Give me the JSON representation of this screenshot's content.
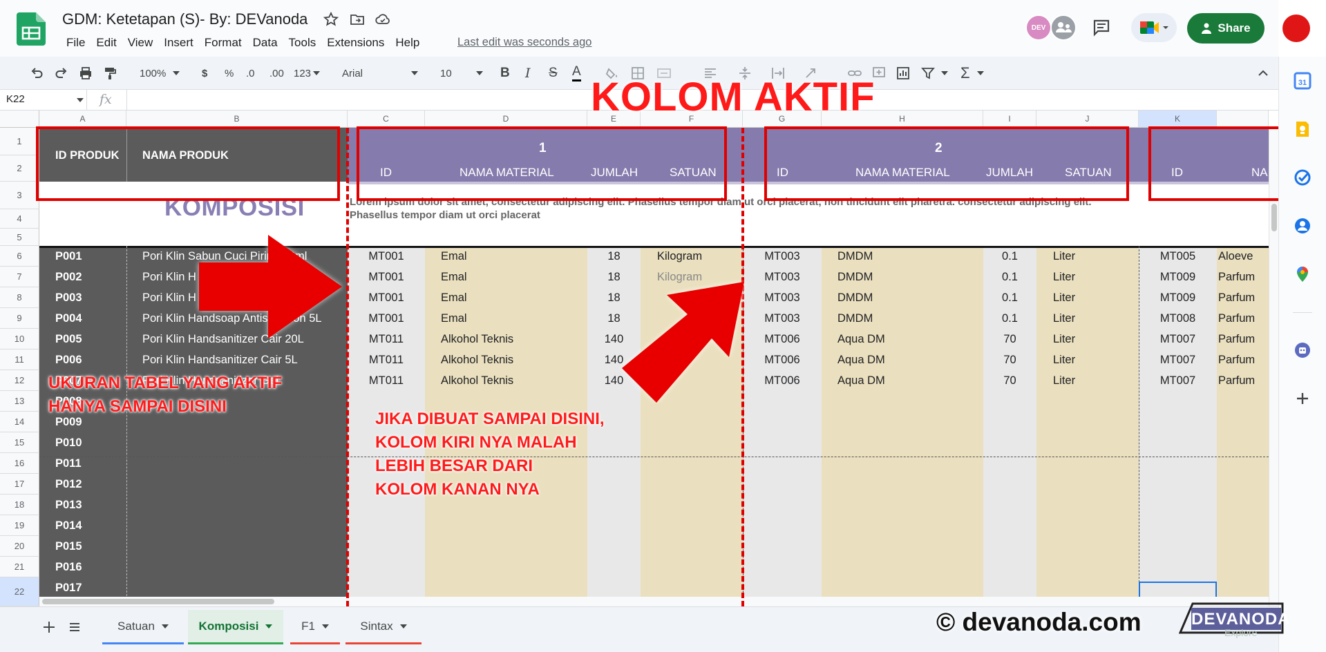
{
  "header": {
    "title": "GDM: Ketetapan (S)- By: DEVanoda",
    "menu": [
      "File",
      "Edit",
      "View",
      "Insert",
      "Format",
      "Data",
      "Tools",
      "Extensions",
      "Help"
    ],
    "last_edit": "Last edit was seconds ago",
    "avatar_label": "DEV",
    "share_label": "Share"
  },
  "toolbar": {
    "zoom": "100%",
    "currency": "$",
    "percent": "%",
    "dec_decrease": ".0",
    "dec_increase": ".00",
    "format_more": "123",
    "font": "Arial",
    "font_size": "10",
    "bold": "B",
    "italic": "I",
    "strike": "S",
    "text_color": "A",
    "functions": "Σ"
  },
  "formula_bar": {
    "cell_ref": "K22",
    "fx": "fx"
  },
  "grid": {
    "columns": [
      "A",
      "B",
      "C",
      "D",
      "E",
      "F",
      "G",
      "H",
      "I",
      "J",
      "K"
    ],
    "rows": [
      "1",
      "2",
      "3",
      "4",
      "5",
      "6",
      "7",
      "8",
      "9",
      "10",
      "11",
      "12",
      "13",
      "14",
      "15",
      "16",
      "17",
      "18",
      "19",
      "20",
      "21",
      "22"
    ],
    "header_id_produk": "ID PRODUK",
    "header_nama_produk": "NAMA PRODUK",
    "group1": "1",
    "group2": "2",
    "subheaders": [
      "ID",
      "NAMA MATERIAL",
      "JUMLAH",
      "SATUAN"
    ],
    "k_subheader_id": "ID",
    "k_subheader_nama": "NA",
    "komposisi": "KOMPOSISI",
    "lorem": "Lorem ipsum dolor sit amet, consectetur adipiscing elit. Phasellus tempor diam ut orci placerat, non tincidunt elit pharetra. consectetur adipiscing elit. Phasellus tempor diam ut orci placerat",
    "products": [
      {
        "id": "P001",
        "name": "Pori Klin Sabun Cuci Piring 80ml"
      },
      {
        "id": "P002",
        "name": "Pori Klin H"
      },
      {
        "id": "P003",
        "name": "Pori Klin H"
      },
      {
        "id": "P004",
        "name": "Pori Klin Handsoap Antis    Lemon 5L"
      },
      {
        "id": "P005",
        "name": "Pori Klin Handsanitizer Cair 20L"
      },
      {
        "id": "P006",
        "name": "Pori Klin Handsanitizer Cair 5L"
      },
      {
        "id": "P007",
        "name": "Pori Klin Handsanitizer Gel"
      },
      {
        "id": "P008",
        "name": ""
      },
      {
        "id": "P009",
        "name": ""
      },
      {
        "id": "P010",
        "name": ""
      },
      {
        "id": "P011",
        "name": ""
      },
      {
        "id": "P012",
        "name": ""
      },
      {
        "id": "P013",
        "name": ""
      },
      {
        "id": "P014",
        "name": ""
      },
      {
        "id": "P015",
        "name": ""
      },
      {
        "id": "P016",
        "name": ""
      },
      {
        "id": "P017",
        "name": ""
      }
    ],
    "materials": [
      {
        "c": "MT001",
        "d": "Emal",
        "e": "18",
        "f": "Kilogram",
        "g": "MT003",
        "h": "DMDM",
        "i": "0.1",
        "j": "Liter",
        "k": "MT005",
        "l": "Aloeve"
      },
      {
        "c": "MT001",
        "d": "Emal",
        "e": "18",
        "f": "Kilogram",
        "g": "MT003",
        "h": "DMDM",
        "i": "0.1",
        "j": "Liter",
        "k": "MT009",
        "l": "Parfum"
      },
      {
        "c": "MT001",
        "d": "Emal",
        "e": "18",
        "f": "",
        "g": "MT003",
        "h": "DMDM",
        "i": "0.1",
        "j": "Liter",
        "k": "MT009",
        "l": "Parfum"
      },
      {
        "c": "MT001",
        "d": "Emal",
        "e": "18",
        "f": "",
        "g": "MT003",
        "h": "DMDM",
        "i": "0.1",
        "j": "Liter",
        "k": "MT008",
        "l": "Parfum"
      },
      {
        "c": "MT011",
        "d": "Alkohol Teknis",
        "e": "140",
        "f": "",
        "g": "MT006",
        "h": "Aqua DM",
        "i": "70",
        "j": "Liter",
        "k": "MT007",
        "l": "Parfum"
      },
      {
        "c": "MT011",
        "d": "Alkohol Teknis",
        "e": "140",
        "f": "",
        "g": "MT006",
        "h": "Aqua DM",
        "i": "70",
        "j": "Liter",
        "k": "MT007",
        "l": "Parfum"
      },
      {
        "c": "MT011",
        "d": "Alkohol Teknis",
        "e": "140",
        "f": "",
        "g": "MT006",
        "h": "Aqua DM",
        "i": "70",
        "j": "Liter",
        "k": "MT007",
        "l": "Parfum"
      }
    ]
  },
  "annotations": {
    "kolom_aktif": "KOLOM AKTIF",
    "left_note": [
      "UKURAN TABEL YANG AKTIF",
      "HANYA SAMPAI DISINI"
    ],
    "mid_note": [
      "JIKA DIBUAT SAMPAI DISINI,",
      "KOLOM KIRI NYA MALAH",
      "LEBIH BESAR DARI",
      "KOLOM KANAN NYA"
    ]
  },
  "tabs": [
    {
      "label": "Satuan",
      "color": "#4285f4"
    },
    {
      "label": "Komposisi",
      "color": "#34a853"
    },
    {
      "label": "F1",
      "color": "#ea4335"
    },
    {
      "label": "Sintax",
      "color": "#ea4335"
    }
  ],
  "watermark": "© devanoda.com",
  "logo_text": "DEVANODA",
  "explore_label": "Explore",
  "colors": {
    "dark_column": "#5b5b5b",
    "purple_header": "#857bad",
    "tan_column": "#eadfbe",
    "gray_column": "#e8e8e8",
    "annotation_red": "#e00000",
    "share_green": "#1a7a3a"
  }
}
